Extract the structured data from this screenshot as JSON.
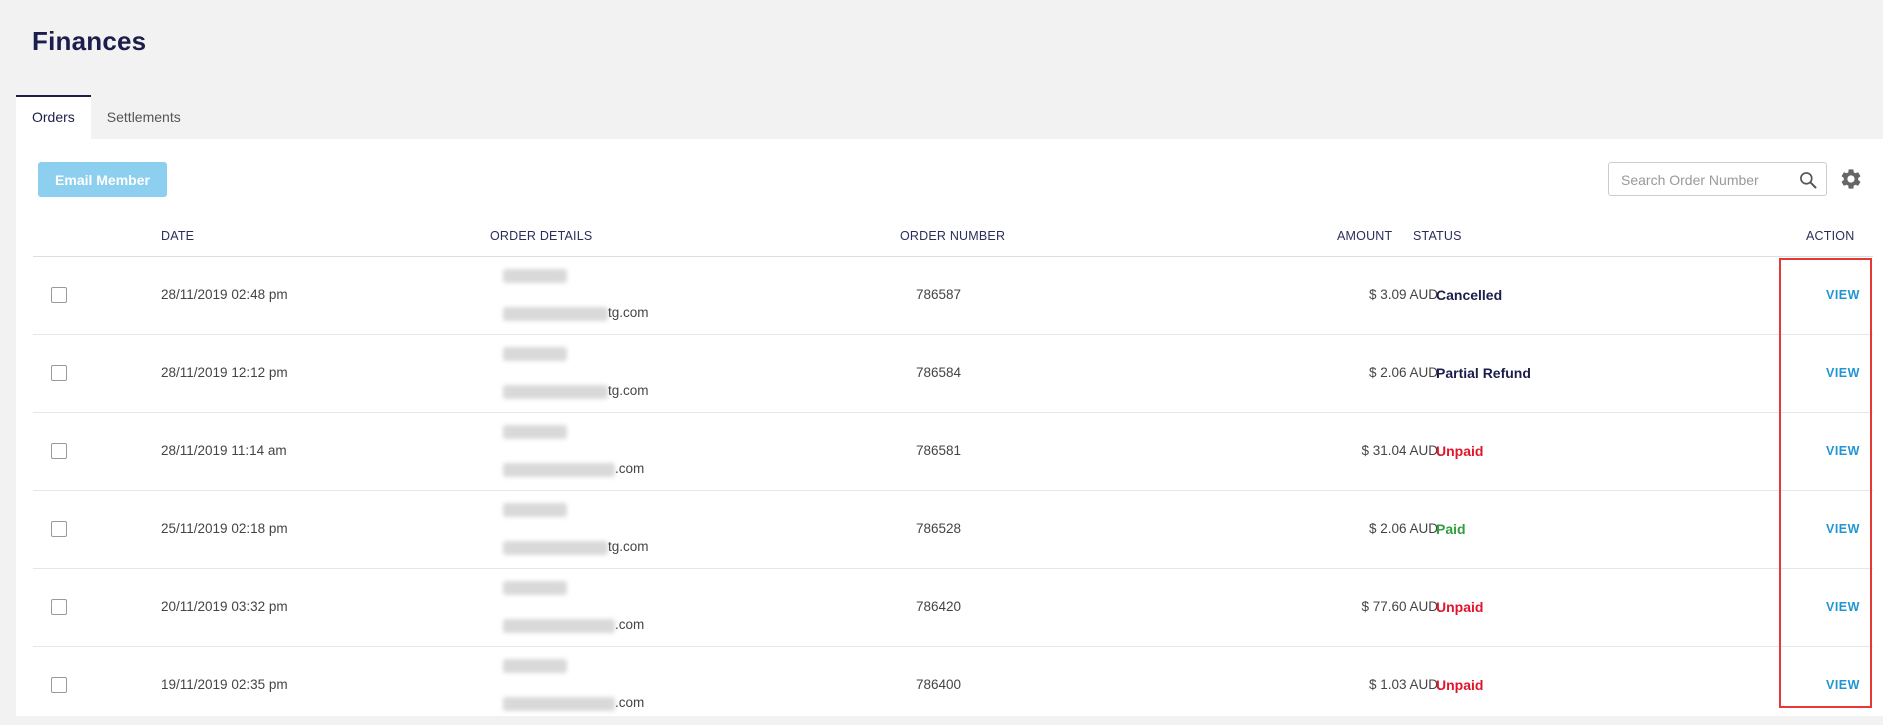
{
  "page": {
    "title": "Finances"
  },
  "tabs": [
    {
      "label": "Orders",
      "active": true
    },
    {
      "label": "Settlements",
      "active": false
    }
  ],
  "toolbar": {
    "email_member_label": "Email Member",
    "search_placeholder": "Search Order Number",
    "search_value": ""
  },
  "table": {
    "headers": {
      "date": "DATE",
      "order_details": "ORDER DETAILS",
      "order_number": "ORDER NUMBER",
      "amount": "AMOUNT",
      "status": "STATUS",
      "action": "ACTION"
    },
    "rows": [
      {
        "date": "28/11/2019 02:48 pm",
        "email_suffix": "tg.com",
        "order_number": "786587",
        "amount": "$ 3.09 AUD",
        "status": "Cancelled",
        "action": "VIEW"
      },
      {
        "date": "28/11/2019 12:12 pm",
        "email_suffix": "tg.com",
        "order_number": "786584",
        "amount": "$ 2.06 AUD",
        "status": "Partial Refund",
        "action": "VIEW"
      },
      {
        "date": "28/11/2019 11:14 am",
        "email_suffix": ".com",
        "order_number": "786581",
        "amount": "$ 31.04 AUD",
        "status": "Unpaid",
        "action": "VIEW"
      },
      {
        "date": "25/11/2019 02:18 pm",
        "email_suffix": "tg.com",
        "order_number": "786528",
        "amount": "$ 2.06 AUD",
        "status": "Paid",
        "action": "VIEW"
      },
      {
        "date": "20/11/2019 03:32 pm",
        "email_suffix": ".com",
        "order_number": "786420",
        "amount": "$ 77.60 AUD",
        "status": "Unpaid",
        "action": "VIEW"
      },
      {
        "date": "19/11/2019 02:35 pm",
        "email_suffix": ".com",
        "order_number": "786400",
        "amount": "$ 1.03 AUD",
        "status": "Unpaid",
        "action": "VIEW"
      }
    ]
  },
  "colors": {
    "status_cancelled": "#1b1e4b",
    "status_partial_refund": "#1b1e4b",
    "status_unpaid": "#e0142b",
    "status_paid": "#2e9e3e",
    "highlight_border": "#e53935"
  },
  "icons": {
    "search": "search-icon",
    "settings": "gear-icon"
  }
}
